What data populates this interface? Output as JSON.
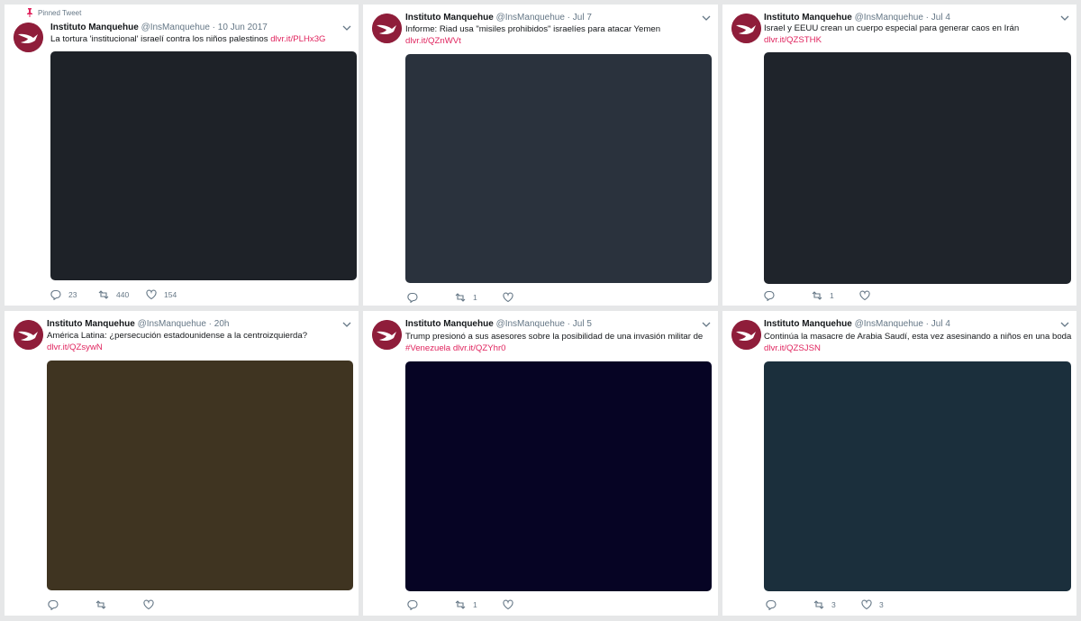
{
  "pinned_label": "Pinned Tweet",
  "tweets": [
    {
      "name": "Instituto Manquehue",
      "handle": "@InsManquehue",
      "dot": "·",
      "date": "10 Jun 2017",
      "text": "La tortura 'institucional' israelí contra los niños palestinos",
      "link": "dlvr.it/PLHx3G",
      "media_color": "#1e2228",
      "replies": "23",
      "retweets": "440",
      "likes": "154"
    },
    {
      "name": "Instituto Manquehue",
      "handle": "@InsManquehue",
      "dot": "·",
      "date": "Jul 7",
      "text": "Informe: Riad usa \"misiles prohibidos\" israelíes para atacar Yemen",
      "link": "dlvr.it/QZnWVt",
      "media_color": "#2a323d",
      "replies": "",
      "retweets": "1",
      "likes": ""
    },
    {
      "name": "Instituto Manquehue",
      "handle": "@InsManquehue",
      "dot": "·",
      "date": "Jul 4",
      "text": "Israel y EEUU crean un cuerpo especial para generar caos en Irán",
      "link": "dlvr.it/QZSTHK",
      "media_color": "#1f242b",
      "replies": "",
      "retweets": "1",
      "likes": ""
    },
    {
      "name": "Instituto Manquehue",
      "handle": "@InsManquehue",
      "dot": "·",
      "date": "20h",
      "text": "América Latina: ¿persecución estadounidense a la centroizquierda?",
      "link": "dlvr.it/QZsywN",
      "media_color": "#3f3421",
      "replies": "",
      "retweets": "",
      "likes": ""
    },
    {
      "name": "Instituto Manquehue",
      "handle": "@InsManquehue",
      "dot": "·",
      "date": "Jul 5",
      "text": "Trump presionó a sus asesores sobre la posibilidad de una invasión militar de",
      "hashtag": "#Venezuela",
      "link": "dlvr.it/QZYhr0",
      "media_color": "#060424",
      "replies": "",
      "retweets": "1",
      "likes": ""
    },
    {
      "name": "Instituto Manquehue",
      "handle": "@InsManquehue",
      "dot": "·",
      "date": "Jul 4",
      "text": "Continúa la masacre de Arabia Saudí, esta vez asesinando a niños en una boda",
      "link": "dlvr.it/QZSJSN",
      "media_color": "#1b2f3c",
      "replies": "",
      "retweets": "3",
      "likes": "3"
    }
  ],
  "icons": {
    "avatar": "bird-logo-icon",
    "pin": "pin-icon",
    "menu": "chevron-down-icon",
    "reply": "reply-icon",
    "retweet": "retweet-icon",
    "like": "heart-icon"
  },
  "colors": {
    "link": "#e0245e",
    "avatar": "#8f1d3a",
    "muted": "#657786"
  }
}
